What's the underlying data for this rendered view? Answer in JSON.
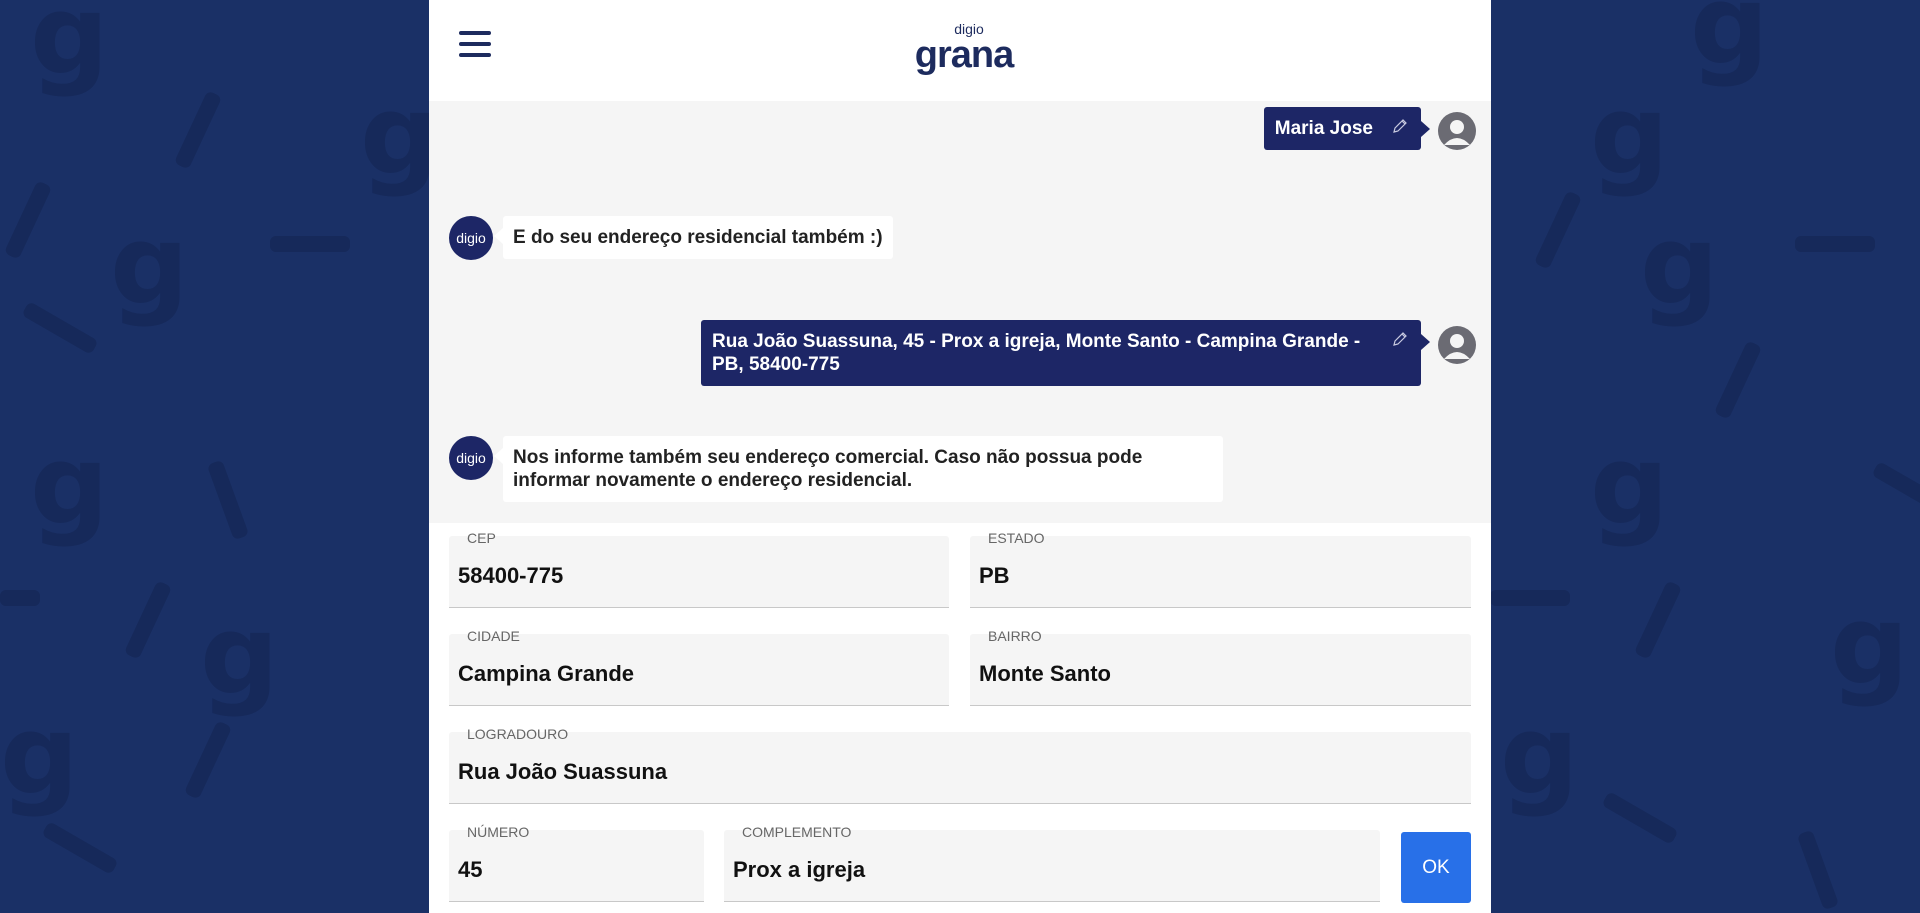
{
  "app": {
    "logo_small": "digio",
    "logo_big": "grana"
  },
  "chat": {
    "messages": [
      {
        "from": "user",
        "text": "Maria Jose"
      },
      {
        "from": "bot",
        "avatar": "digio",
        "text": "E do seu endereço residencial também :)"
      },
      {
        "from": "user",
        "text": "Rua João Suassuna, 45 - Prox a igreja, Monte Santo - Campina Grande - PB, 58400-775"
      },
      {
        "from": "bot",
        "avatar": "digio",
        "text": "Nos informe também seu endereço comercial. Caso não possua pode informar novamente o endereço residencial."
      }
    ]
  },
  "form": {
    "cep": {
      "label": "CEP",
      "value": "58400-775"
    },
    "estado": {
      "label": "ESTADO",
      "value": "PB"
    },
    "cidade": {
      "label": "CIDADE",
      "value": "Campina Grande"
    },
    "bairro": {
      "label": "BAIRRO",
      "value": "Monte Santo"
    },
    "logradouro": {
      "label": "LOGRADOURO",
      "value": "Rua João Suassuna"
    },
    "numero": {
      "label": "NÚMERO",
      "value": "45"
    },
    "complemento": {
      "label": "COMPLEMENTO",
      "value": "Prox a igreja"
    },
    "submit_label": "OK"
  },
  "icons": {
    "menu": "hamburger-menu-icon",
    "edit": "pencil-edit-icon",
    "user_avatar": "user-avatar-icon"
  },
  "colors": {
    "background": "#1a3066",
    "brand_navy": "#1d2666",
    "button_blue": "#2870e8"
  }
}
